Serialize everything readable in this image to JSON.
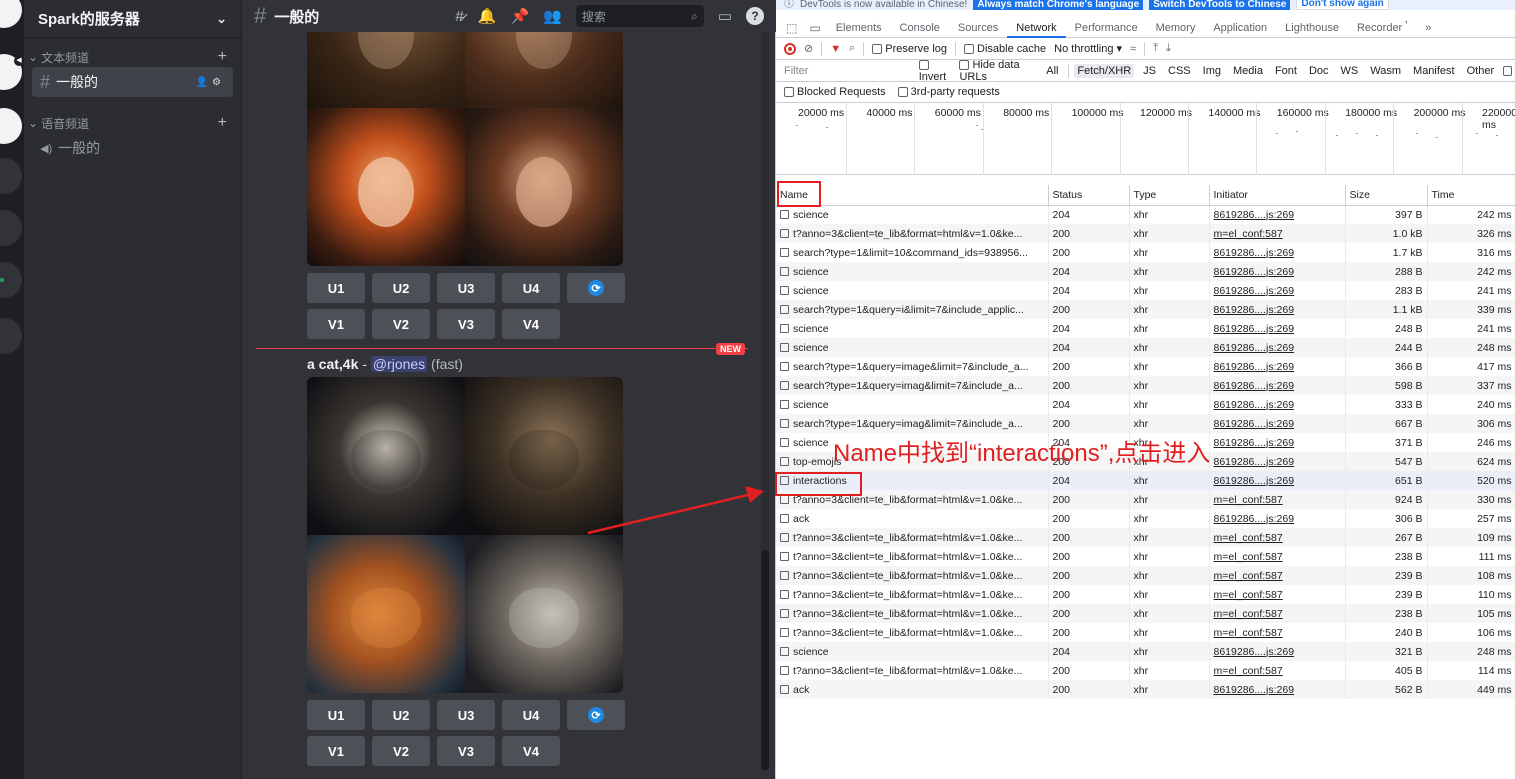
{
  "server": {
    "name": "Spark的服务器"
  },
  "categories": {
    "text": "文本频道",
    "voice": "语音频道"
  },
  "channels": {
    "text_channel": "一般的",
    "voice_channel": "一般的"
  },
  "topbar": {
    "channel": "一般的",
    "search_placeholder": "搜索"
  },
  "buttons": {
    "u": [
      "U1",
      "U2",
      "U3",
      "U4"
    ],
    "v": [
      "V1",
      "V2",
      "V3",
      "V4"
    ]
  },
  "new_badge": "NEW",
  "message": {
    "prompt": "a cat,4k",
    "dash": " - ",
    "mention": "@rjones",
    "speed": " (fast)"
  },
  "devtools": {
    "info_text": "DevTools is now available in Chinese!",
    "info_btn1": "Always match Chrome's language",
    "info_btn2": "Switch DevTools to Chinese",
    "info_btn3": "Don't show again",
    "tabs": [
      "Elements",
      "Console",
      "Sources",
      "Network",
      "Performance",
      "Memory",
      "Application",
      "Lighthouse",
      "Recorder 𝄒",
      "»"
    ],
    "selected_tab": "Network",
    "toolbar": {
      "preserve_log": "Preserve log",
      "disable_cache": "Disable cache",
      "throttling": "No throttling"
    },
    "filter": {
      "placeholder": "Filter",
      "invert": "Invert",
      "hide_data": "Hide data URLs",
      "types": [
        "All",
        "Fetch/XHR",
        "JS",
        "CSS",
        "Img",
        "Media",
        "Font",
        "Doc",
        "WS",
        "Wasm",
        "Manifest",
        "Other"
      ],
      "selected_type": "Fetch/XHR"
    },
    "blocked_requests": "Blocked Requests",
    "third_party": "3rd-party requests",
    "timeline_labels": [
      "20000 ms",
      "40000 ms",
      "60000 ms",
      "80000 ms",
      "100000 ms",
      "120000 ms",
      "140000 ms",
      "160000 ms",
      "180000 ms",
      "200000 ms",
      "220000 ms"
    ],
    "columns": [
      "Name",
      "Status",
      "Type",
      "Initiator",
      "Size",
      "Time"
    ],
    "rows": [
      {
        "name": "science",
        "status": "204",
        "type": "xhr",
        "initiator": "8619286....js:269",
        "size": "397 B",
        "time": "242 ms"
      },
      {
        "name": "t?anno=3&client=te_lib&format=html&v=1.0&ke...",
        "status": "200",
        "type": "xhr",
        "initiator": "m=el_conf:587",
        "size": "1.0 kB",
        "time": "326 ms"
      },
      {
        "name": "search?type=1&limit=10&command_ids=938956...",
        "status": "200",
        "type": "xhr",
        "initiator": "8619286....js:269",
        "size": "1.7 kB",
        "time": "316 ms"
      },
      {
        "name": "science",
        "status": "204",
        "type": "xhr",
        "initiator": "8619286....js:269",
        "size": "288 B",
        "time": "242 ms"
      },
      {
        "name": "science",
        "status": "204",
        "type": "xhr",
        "initiator": "8619286....js:269",
        "size": "283 B",
        "time": "241 ms"
      },
      {
        "name": "search?type=1&query=i&limit=7&include_applic...",
        "status": "200",
        "type": "xhr",
        "initiator": "8619286....js:269",
        "size": "1.1 kB",
        "time": "339 ms"
      },
      {
        "name": "science",
        "status": "204",
        "type": "xhr",
        "initiator": "8619286....js:269",
        "size": "248 B",
        "time": "241 ms"
      },
      {
        "name": "science",
        "status": "204",
        "type": "xhr",
        "initiator": "8619286....js:269",
        "size": "244 B",
        "time": "248 ms"
      },
      {
        "name": "search?type=1&query=image&limit=7&include_a...",
        "status": "200",
        "type": "xhr",
        "initiator": "8619286....js:269",
        "size": "366 B",
        "time": "417 ms"
      },
      {
        "name": "search?type=1&query=imag&limit=7&include_a...",
        "status": "200",
        "type": "xhr",
        "initiator": "8619286....js:269",
        "size": "598 B",
        "time": "337 ms"
      },
      {
        "name": "science",
        "status": "204",
        "type": "xhr",
        "initiator": "8619286....js:269",
        "size": "333 B",
        "time": "240 ms"
      },
      {
        "name": "search?type=1&query=imag&limit=7&include_a...",
        "status": "200",
        "type": "xhr",
        "initiator": "8619286....js:269",
        "size": "667 B",
        "time": "306 ms"
      },
      {
        "name": "science",
        "status": "204",
        "type": "xhr",
        "initiator": "8619286....js:269",
        "size": "371 B",
        "time": "246 ms"
      },
      {
        "name": "top-emojis",
        "status": "200",
        "type": "xhr",
        "initiator": "8619286....js:269",
        "size": "547 B",
        "time": "624 ms"
      },
      {
        "name": "interactions",
        "status": "204",
        "type": "xhr",
        "initiator": "8619286....js:269",
        "size": "651 B",
        "time": "520 ms"
      },
      {
        "name": "t?anno=3&client=te_lib&format=html&v=1.0&ke...",
        "status": "200",
        "type": "xhr",
        "initiator": "m=el_conf:587",
        "size": "924 B",
        "time": "330 ms"
      },
      {
        "name": "ack",
        "status": "200",
        "type": "xhr",
        "initiator": "8619286....js:269",
        "size": "306 B",
        "time": "257 ms"
      },
      {
        "name": "t?anno=3&client=te_lib&format=html&v=1.0&ke...",
        "status": "200",
        "type": "xhr",
        "initiator": "m=el_conf:587",
        "size": "267 B",
        "time": "109 ms"
      },
      {
        "name": "t?anno=3&client=te_lib&format=html&v=1.0&ke...",
        "status": "200",
        "type": "xhr",
        "initiator": "m=el_conf:587",
        "size": "238 B",
        "time": "111 ms"
      },
      {
        "name": "t?anno=3&client=te_lib&format=html&v=1.0&ke...",
        "status": "200",
        "type": "xhr",
        "initiator": "m=el_conf:587",
        "size": "239 B",
        "time": "108 ms"
      },
      {
        "name": "t?anno=3&client=te_lib&format=html&v=1.0&ke...",
        "status": "200",
        "type": "xhr",
        "initiator": "m=el_conf:587",
        "size": "239 B",
        "time": "110 ms"
      },
      {
        "name": "t?anno=3&client=te_lib&format=html&v=1.0&ke...",
        "status": "200",
        "type": "xhr",
        "initiator": "m=el_conf:587",
        "size": "238 B",
        "time": "105 ms"
      },
      {
        "name": "t?anno=3&client=te_lib&format=html&v=1.0&ke...",
        "status": "200",
        "type": "xhr",
        "initiator": "m=el_conf:587",
        "size": "240 B",
        "time": "106 ms"
      },
      {
        "name": "science",
        "status": "204",
        "type": "xhr",
        "initiator": "8619286....js:269",
        "size": "321 B",
        "time": "248 ms"
      },
      {
        "name": "t?anno=3&client=te_lib&format=html&v=1.0&ke...",
        "status": "200",
        "type": "xhr",
        "initiator": "m=el_conf:587",
        "size": "405 B",
        "time": "114 ms"
      },
      {
        "name": "ack",
        "status": "200",
        "type": "xhr",
        "initiator": "8619286....js:269",
        "size": "562 B",
        "time": "449 ms"
      }
    ],
    "highlight_name": "interactions"
  },
  "annotation": "Name中找到“interactions”,点击进入",
  "colors": {
    "annotation_red": "#e02020",
    "devtools_accent": "#1a73e8",
    "discord_bg": "#313338"
  }
}
